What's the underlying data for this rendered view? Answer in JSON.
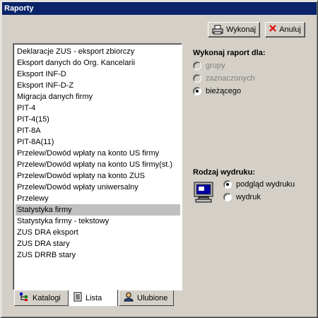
{
  "window": {
    "title": "Raporty"
  },
  "toolbar": {
    "execute_label": "Wykonaj",
    "cancel_label": "Anuluj"
  },
  "reports": {
    "items": [
      "Deklaracje ZUS - eksport zbiorczy",
      "Eksport danych do Org. Kancelarii",
      "Eksport INF-D",
      "Eksport INF-D-Z",
      "Migracja danych firmy",
      "PIT-4",
      "PIT-4(15)",
      "PIT-8A",
      "PIT-8A(11)",
      "Przelew/Dowód wpłaty na konto US firmy",
      "Przelew/Dowód wpłaty na konto US firmy(st.)",
      "Przelew/Dowód wpłaty na konto ZUS",
      "Przelew/Dowód wpłaty uniwersalny",
      "Przelewy",
      "Statystyka firmy",
      "Statystyka firmy - tekstowy",
      "ZUS DRA eksport",
      "ZUS DRA stary",
      "ZUS DRRB stary"
    ],
    "selected": "Statystyka firmy"
  },
  "tabs": {
    "catalogs": "Katalogi",
    "list": "Lista",
    "favorites": "Ulubione",
    "active": "Lista"
  },
  "run_for": {
    "title": "Wykonaj raport dla:",
    "options": [
      "grupy",
      "zaznaczonych",
      "bieżącego"
    ],
    "disabled": [
      "grupy",
      "zaznaczonych"
    ],
    "selected": "bieżącego"
  },
  "print_type": {
    "title": "Rodzaj wydruku:",
    "options": [
      "podgląd wydruku",
      "wydruk"
    ],
    "selected": "podgląd wydruku"
  },
  "icons": {
    "execute": "printer-icon",
    "cancel": "red-x-icon",
    "catalogs": "tree-icon",
    "list": "document-icon",
    "favorites": "user-icon",
    "print_preview": "monitor-icon"
  },
  "colors": {
    "titlebar": "#0a246a",
    "face": "#d4d0c8",
    "selection": "#c0c0c0"
  }
}
